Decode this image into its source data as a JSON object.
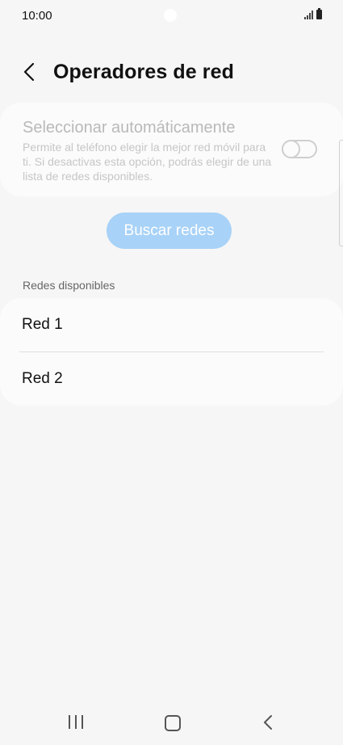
{
  "status_bar": {
    "time": "10:00",
    "signal_icon": "signal-bars-icon",
    "battery_icon": "battery-icon"
  },
  "header": {
    "title": "Operadores de red",
    "back_icon": "chevron-left-icon"
  },
  "auto_select": {
    "title": "Seleccionar automáticamente",
    "description": "Permite al teléfono elegir la mejor red móvil para ti. Si desactivas esta opción, podrás elegir de una lista de redes disponibles.",
    "toggle_on": false
  },
  "search_button": {
    "label": "Buscar redes"
  },
  "available": {
    "section_label": "Redes disponibles",
    "networks": [
      {
        "label": "Red 1"
      },
      {
        "label": "Red 2"
      }
    ]
  },
  "nav_bar": {
    "recents_icon": "recents-icon",
    "home_icon": "home-icon",
    "back_icon": "back-icon"
  },
  "colors": {
    "background": "#f6f6f6",
    "card": "#fbfbfb",
    "accent_disabled": "#a8d2f7",
    "disabled_text": "#b9b9b9"
  }
}
